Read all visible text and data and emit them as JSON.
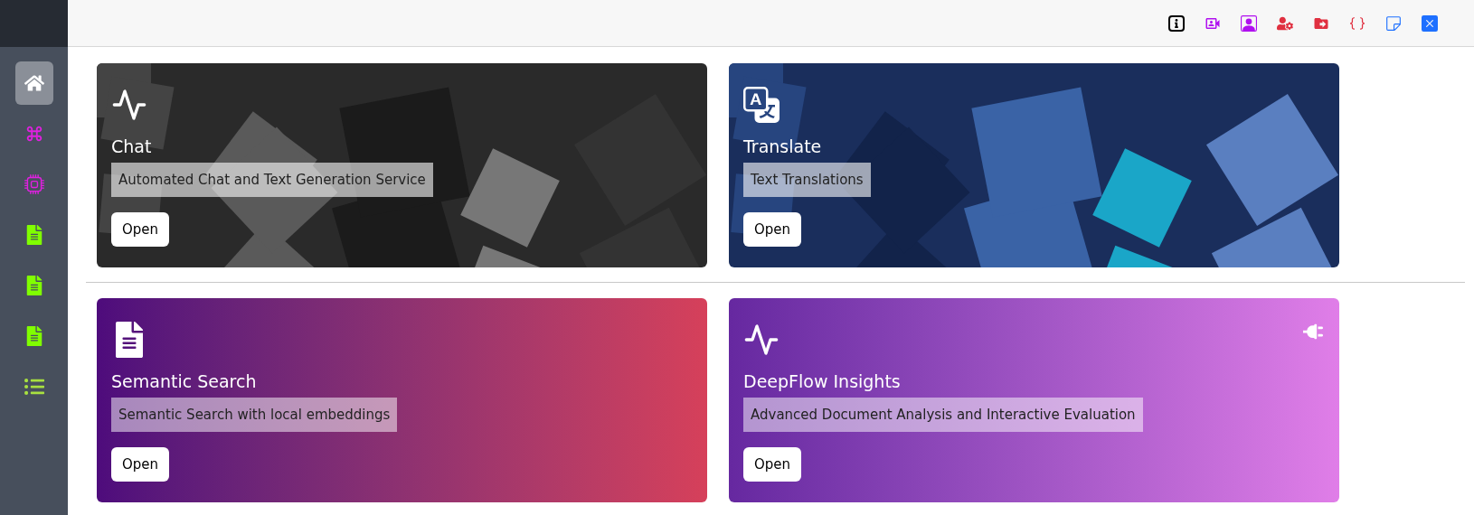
{
  "sidebar": {
    "items": [
      {
        "selected": true
      },
      {
        "selected": false
      },
      {
        "selected": false
      },
      {
        "selected": false
      },
      {
        "selected": false
      },
      {
        "selected": false
      },
      {
        "selected": false
      }
    ]
  },
  "cards": [
    {
      "title": "Chat",
      "description": "Automated Chat and Text Generation Service",
      "button": "Open",
      "kind": "picture"
    },
    {
      "title": "Translate",
      "description": "Text Translations",
      "button": "Open",
      "kind": "picture"
    },
    {
      "title": "Semantic Search",
      "description": "Semantic Search with local embeddings",
      "button": "Open",
      "kind": "gradient"
    },
    {
      "title": "DeepFlow Insights",
      "description": "Advanced Document Analysis and Interactive Evaluation",
      "button": "Open",
      "kind": "gradient"
    }
  ]
}
